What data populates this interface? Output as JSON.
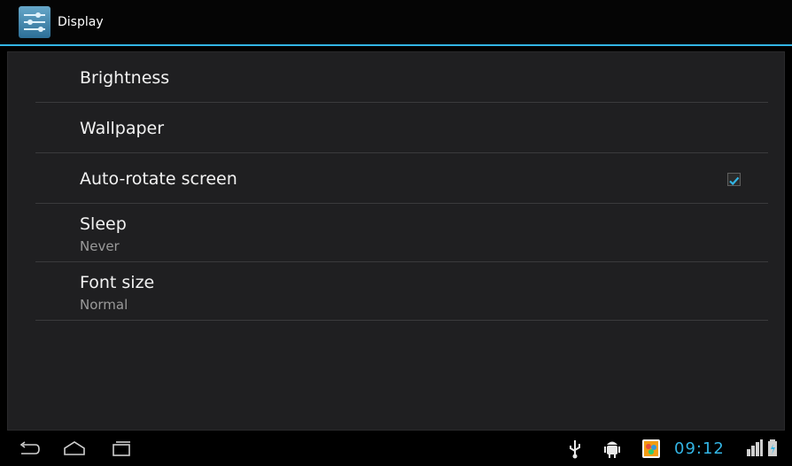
{
  "action_bar": {
    "title": "Display",
    "icon": "display-settings-icon",
    "accent_color": "#33b5e5"
  },
  "settings": [
    {
      "label": "Brightness"
    },
    {
      "label": "Wallpaper"
    },
    {
      "label": "Auto-rotate screen",
      "checked": true
    },
    {
      "label": "Sleep",
      "summary": "Never"
    },
    {
      "label": "Font size",
      "summary": "Normal"
    }
  ],
  "nav_bar": {
    "buttons": [
      "back-icon",
      "home-icon",
      "recent-apps-icon"
    ]
  },
  "status_bar": {
    "time": "09:12",
    "icons": [
      "usb-icon",
      "android-debug-icon",
      "gallery-notification-icon",
      "signal-icon",
      "battery-icon"
    ]
  }
}
